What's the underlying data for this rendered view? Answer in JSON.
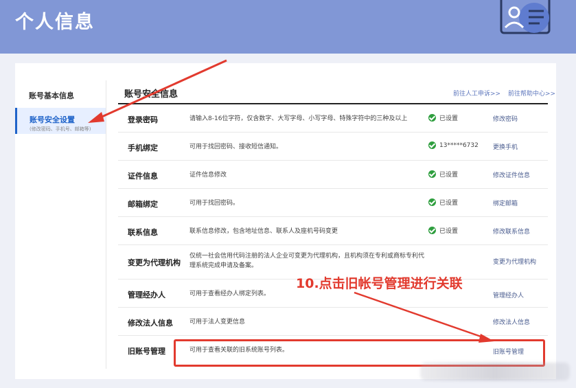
{
  "header": {
    "title": "个人信息"
  },
  "sidebar": {
    "basic_label": "账号基本信息",
    "active_label": "账号安全设置",
    "active_hint": "(修改密码、手机号、邮箱等)"
  },
  "main": {
    "title": "账号安全信息",
    "links": [
      "前往人工申诉>>",
      "前往帮助中心>>"
    ],
    "rows": [
      {
        "name": "登录密码",
        "desc": "请输入8-16位字符，仅含数字、大写字母、小写字母、特殊字符中的三种及以上",
        "status": "已设置",
        "action": "修改密码"
      },
      {
        "name": "手机绑定",
        "desc": "可用于找回密码、接收短信通知。",
        "status": "13*****6732",
        "action": "更换手机"
      },
      {
        "name": "证件信息",
        "desc": "证件信息修改",
        "status": "已设置",
        "action": "修改证件信息"
      },
      {
        "name": "邮箱绑定",
        "desc": "可用于找回密码。",
        "status": "已设置",
        "action": "绑定邮箱"
      },
      {
        "name": "联系信息",
        "desc": "联系信息修改，包含地址信息、联系人及座机号码变更",
        "status": "已设置",
        "action": "修改联系信息"
      },
      {
        "name": "变更为代理机构",
        "desc": "仅统一社会信用代码注册的法人企业可变更为代理机构，且机构须在专利或商标专利代理系统完成申请及备案。",
        "status": "",
        "action": "变更为代理机构"
      },
      {
        "name": "管理经办人",
        "desc": "可用于查看经办人绑定列表。",
        "status": "",
        "action": "管理经办人"
      },
      {
        "name": "修改法人信息",
        "desc": "可用于法人变更信息",
        "status": "",
        "action": "修改法人信息"
      },
      {
        "name": "旧账号管理",
        "desc": "可用于查看关联的旧系统账号列表。",
        "status": "",
        "action": "旧账号管理"
      }
    ]
  },
  "annotation": {
    "text": "10.点击旧帐号管理进行关联"
  },
  "colors": {
    "header_bg": "#8197d6",
    "accent": "#1f63c9",
    "annotation_red": "#e23a2e",
    "check_green": "#2e9e3e"
  }
}
